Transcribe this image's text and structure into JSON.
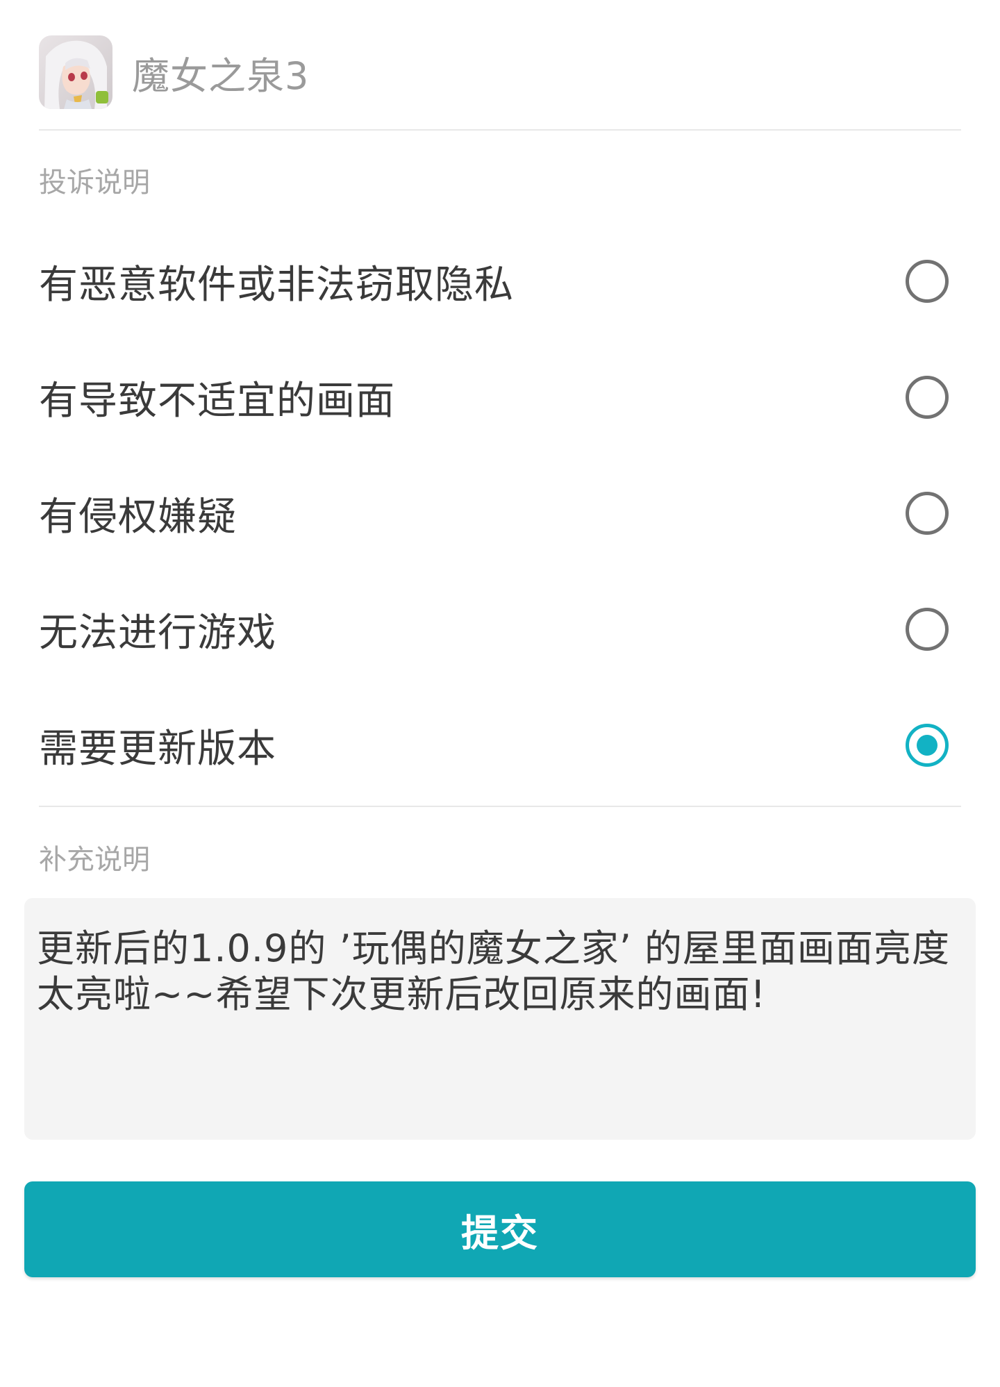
{
  "app": {
    "name": "魔女之泉3",
    "icon": "app-icon-anime-girl"
  },
  "complaint": {
    "label": "投诉说明",
    "options": [
      {
        "label": "有恶意软件或非法窃取隐私",
        "checked": false
      },
      {
        "label": "有导致不适宜的画面",
        "checked": false
      },
      {
        "label": "有侵权嫌疑",
        "checked": false
      },
      {
        "label": "无法进行游戏",
        "checked": false
      },
      {
        "label": "需要更新版本",
        "checked": true
      }
    ]
  },
  "supplement": {
    "label": "补充说明",
    "text": "更新后的1.0.9的 ’玩偶的魔女之家’ 的屋里面画面亮度太亮啦~~希望下次更新后改回原来的画面!"
  },
  "submit": {
    "label": "提交"
  },
  "colors": {
    "accent": "#12b2c4",
    "button": "#10a7b4",
    "radio_unchecked": "#727272",
    "text_primary": "#3a3a3a",
    "text_secondary": "#a7a7a7"
  }
}
